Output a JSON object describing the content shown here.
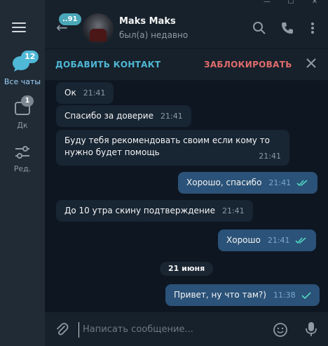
{
  "window": {
    "minimize": "—",
    "maximize": "☐",
    "close": "✕"
  },
  "rail": {
    "items": [
      {
        "label": "Все чаты",
        "badge": "12"
      },
      {
        "label": "Дк",
        "badge": "1"
      },
      {
        "label": "Ред.",
        "badge": ""
      }
    ]
  },
  "header": {
    "back_badge": "..91",
    "name": "Maks Maks",
    "status": "был(а) недавно"
  },
  "actionbar": {
    "add_contact": "ДОБАВИТЬ КОНТАКТ",
    "block": "ЗАБЛОКИРОВАТЬ"
  },
  "messages": [
    {
      "text": "Ок",
      "time": "21:41",
      "dir": "in"
    },
    {
      "text": "Спасибо за доверие",
      "time": "21:41",
      "dir": "in"
    },
    {
      "text": "Буду тебя рекомендовать своим если кому то нужно будет помощь",
      "time": "21:41",
      "dir": "in"
    },
    {
      "text": "Хорошо, спасибо",
      "time": "21:41",
      "dir": "out",
      "read": true
    },
    {
      "text": "До 10 утра скину подтверждение",
      "time": "21:41",
      "dir": "in"
    },
    {
      "text": "Хорошо",
      "time": "21:41",
      "dir": "out",
      "read": true
    },
    {
      "text": "Привет, ну что там?)",
      "time": "11:38",
      "dir": "out",
      "read": false
    }
  ],
  "date_separator": "21 июня",
  "composer": {
    "placeholder": "Написать сообщение..."
  },
  "colors": {
    "accent": "#4fb8d6",
    "danger": "#e06c6c",
    "bubble_out": "#2b5278",
    "bubble_in": "#182533"
  }
}
